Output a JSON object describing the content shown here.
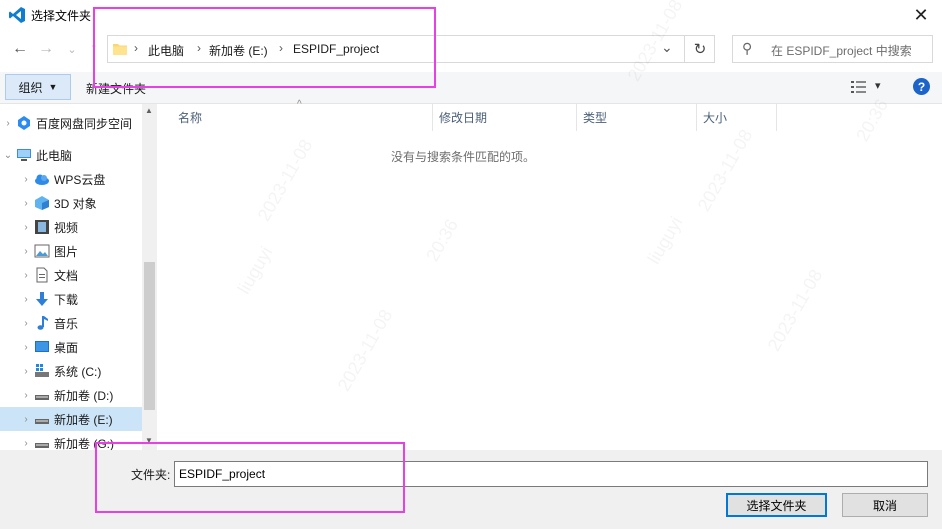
{
  "window": {
    "title": "选择文件夹",
    "close_glyph": "✕"
  },
  "nav": {
    "back_glyph": "←",
    "forward_glyph": "→",
    "recent_glyph": "⌄",
    "up_glyph": "↑",
    "breadcrumb": [
      "此电脑",
      "新加卷 (E:)",
      "ESPIDF_project"
    ],
    "dropdown_glyph": "⌄",
    "refresh_glyph": "↻",
    "search_placeholder": "在 ESPIDF_project 中搜索",
    "search_glyph": "⚲"
  },
  "toolbar": {
    "organize_label": "组织",
    "new_folder_label": "新建文件夹",
    "help_label": "?",
    "view_glyph": "▾"
  },
  "sidebar": {
    "items": [
      {
        "label": "百度网盘同步空间",
        "icon": "baidu-cloud-icon",
        "expander": ">"
      },
      {
        "label": "此电脑",
        "icon": "this-pc-icon",
        "expander": "v"
      },
      {
        "label": "WPS云盘",
        "icon": "wps-cloud-icon",
        "expander": ">"
      },
      {
        "label": "3D 对象",
        "icon": "3d-objects-icon",
        "expander": ">"
      },
      {
        "label": "视频",
        "icon": "video-icon",
        "expander": ">"
      },
      {
        "label": "图片",
        "icon": "pictures-icon",
        "expander": ">"
      },
      {
        "label": "文档",
        "icon": "documents-icon",
        "expander": ">"
      },
      {
        "label": "下载",
        "icon": "downloads-icon",
        "expander": ">"
      },
      {
        "label": "音乐",
        "icon": "music-icon",
        "expander": ">"
      },
      {
        "label": "桌面",
        "icon": "desktop-icon",
        "expander": ">"
      },
      {
        "label": "系统 (C:)",
        "icon": "system-drive-icon",
        "expander": ">"
      },
      {
        "label": "新加卷 (D:)",
        "icon": "drive-icon",
        "expander": ">"
      },
      {
        "label": "新加卷 (E:)",
        "icon": "drive-icon",
        "expander": ">",
        "selected": true
      },
      {
        "label": "新加卷 (G:)",
        "icon": "drive-icon",
        "expander": ">"
      }
    ]
  },
  "content": {
    "columns": [
      "名称",
      "修改日期",
      "类型",
      "大小"
    ],
    "sort_indicator": "^",
    "empty_message": "没有与搜索条件匹配的项。"
  },
  "footer": {
    "folder_label": "文件夹:",
    "folder_value": "ESPIDF_project",
    "select_button": "选择文件夹",
    "cancel_button": "取消"
  },
  "watermark": {
    "user": "liuguyi",
    "date": "2023-11-08",
    "time": "20:36"
  },
  "colors": {
    "accent": "#0078d7",
    "selection": "#cce4f7",
    "annotation": "#e83fe6",
    "help": "#1d64c8"
  }
}
